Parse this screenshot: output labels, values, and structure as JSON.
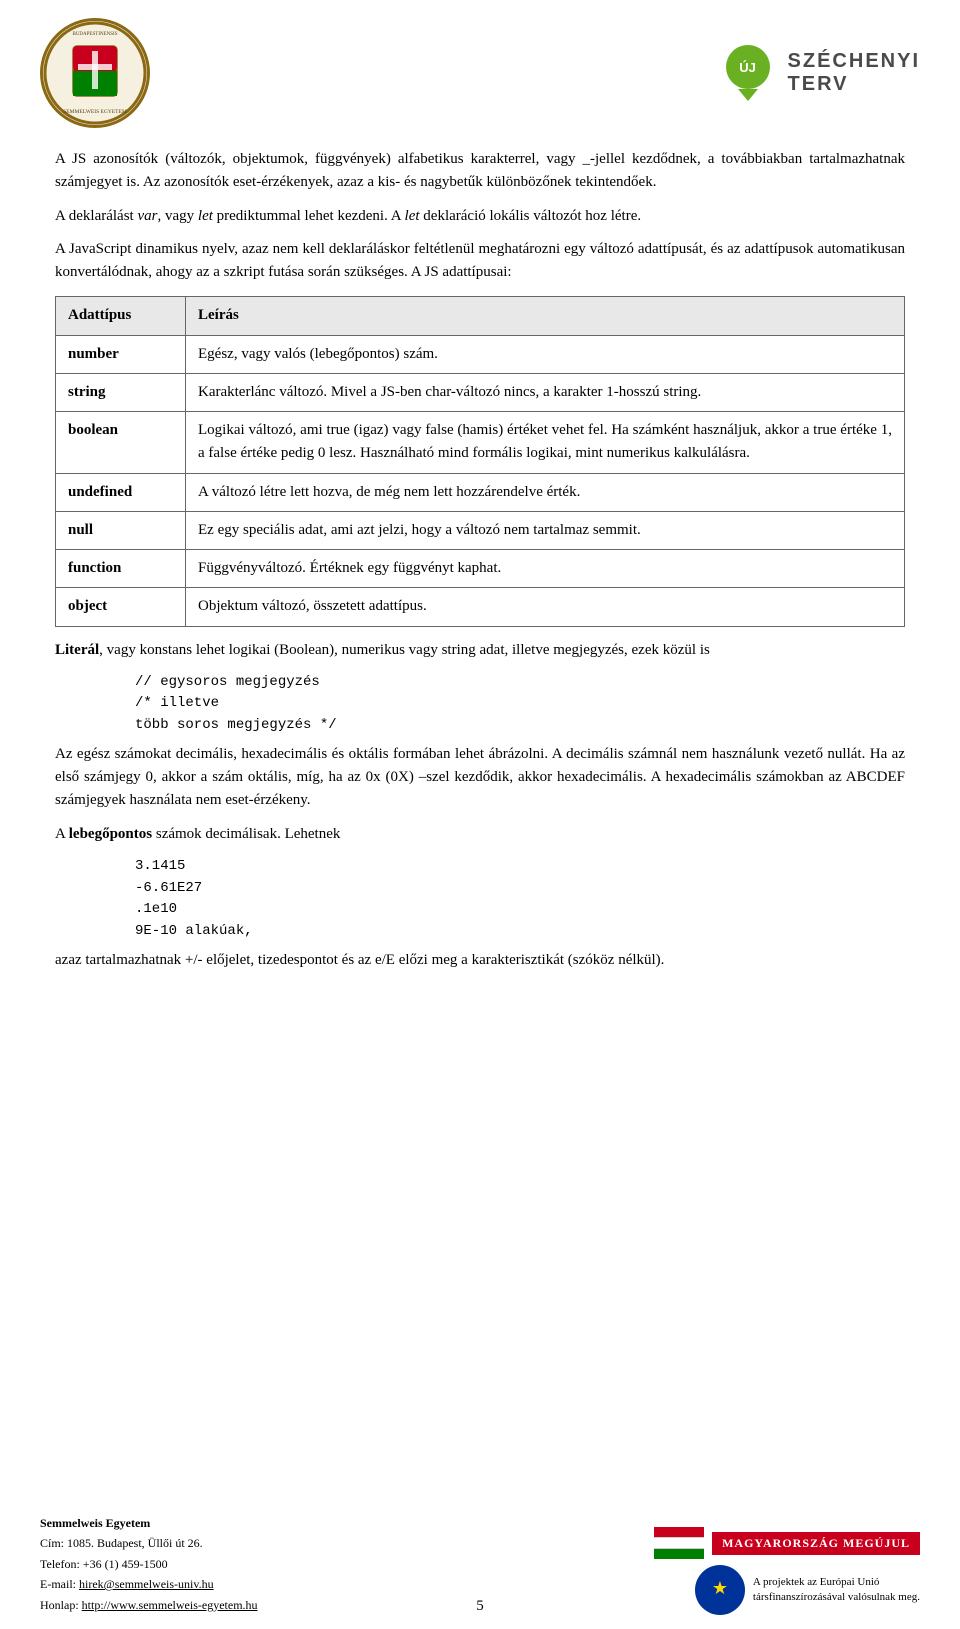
{
  "header": {
    "logo_alt": "Semmelweis Egyetem logo",
    "szechenyi_uj": "ÚJ",
    "szechenyi_name": "SZÉCHENYI",
    "szechenyi_terv": "TERV"
  },
  "content": {
    "paragraph1": "A JS azonosítók (változók, objektumok, függvények) alfabetikus karakterrel, vagy _-jellel kezdődnek, a továbbiakban tartalmazhatnak számjegyet is. Az azonosítók eset-érzékenyek, azaz a kis- és nagybetűk különbözőnek tekintendőek.",
    "paragraph2": "A deklarálást var, vagy let prediktummal lehet kezdeni. A let deklaráció lokális változót hoz létre.",
    "paragraph3": "A JavaScript dinamikus nyelv, azaz nem kell deklaráláskor feltétlenül meghatározni egy változó adattípusát, és az adattípusok automatikusan konvertálódnak, ahogy az a szkript futása során szükséges. A JS adattípusai:",
    "table": {
      "header": [
        "Adattípus",
        "Leírás"
      ],
      "rows": [
        {
          "type": "number",
          "description": "Egész, vagy valós (lebegőpontos) szám."
        },
        {
          "type": "string",
          "description": "Karakterlánc változó. Mivel a JS-ben char-változó nincs, a karakter 1-hosszú string."
        },
        {
          "type": "boolean",
          "description": "Logikai változó, ami true (igaz) vagy false (hamis) értéket vehet fel. Ha számként használjuk, akkor a true értéke 1, a false értéke pedig 0 lesz. Használható mind formális logikai, mint numerikus kalkulálásra."
        },
        {
          "type": "undefined",
          "description": "A változó létre lett hozva, de még nem lett hozzárendelve érték."
        },
        {
          "type": "null",
          "description": "Ez egy speciális adat, ami azt jelzi, hogy a változó nem tartalmaz semmit."
        },
        {
          "type": "function",
          "description": "Függvényváltozó. Értéknek egy függvényt kaphat."
        },
        {
          "type": "object",
          "description": "Objektum változó, összetett adattípus."
        }
      ]
    },
    "literal_text1": "Literál, vagy konstans lehet logikai (Boolean), numerikus vagy string adat, illetve megjegyzés, ezek közül is",
    "code1": "// egysoros megjegyzés\n/* illetve\ntöbb soros megjegyzés */",
    "paragraph4": "Az egész számokat decimális, hexadecimális és oktális formában lehet ábrázolni. A decimális számnál nem használunk vezető nullát. Ha az első számjegy 0, akkor a szám oktális, míg, ha az 0x (0X) –szel kezdődik, akkor hexadecimális. A hexadecimális számokban az ABCDEF számjegyek használata nem eset-érzékeny.",
    "paragraph5": "A lebegőpontos számok decimálisak. Lehetnek",
    "code2": "3.1415\n-6.61E27\n.1e10\n9E-10 alakúak,",
    "paragraph6": "azaz tartalmazhatnak +/- előjelet, tizedespontot és az e/E előzi meg a karakterisztikát (szóköz nélkül).",
    "page_number": "5"
  },
  "footer": {
    "institution": "Semmelweis Egyetem",
    "address": "Cím: 1085. Budapest, Üllői út 26.",
    "phone": "Telefon: +36 (1) 459-1500",
    "email": "E-mail: hirek@semmelweis-univ.hu",
    "website": "Honlap: http://www.semmelweis-egyetem.hu",
    "badge1": "MAGYARORSZÁG MEGÚJUL",
    "eu_text1": "A projektek az Európai Unió",
    "eu_text2": "társfinanszírozásával valósulnak meg."
  }
}
